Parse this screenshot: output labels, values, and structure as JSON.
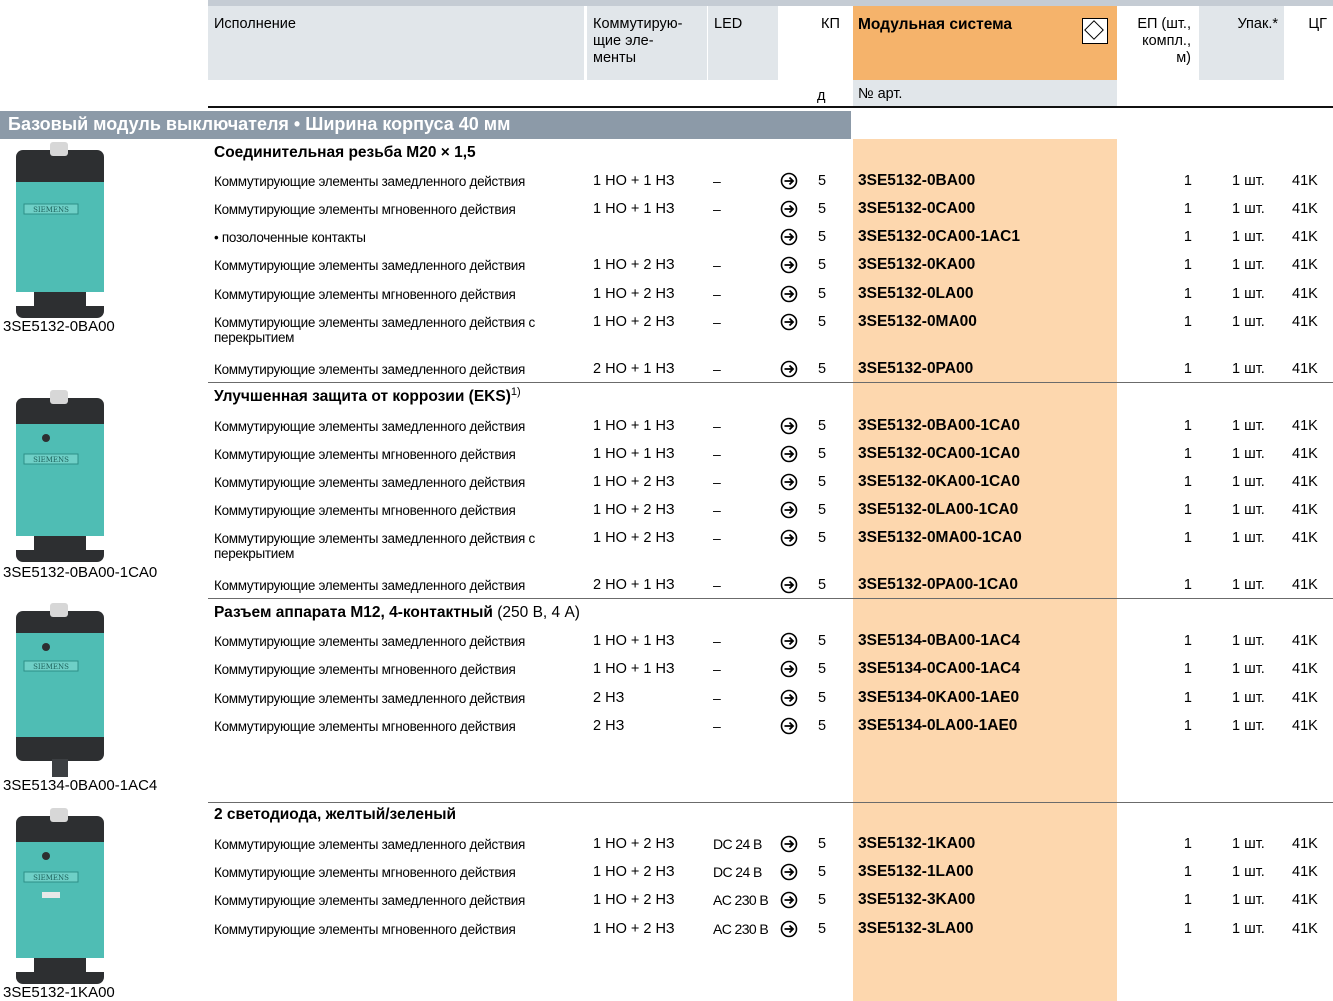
{
  "header": {
    "execution": "Исполнение",
    "switching": "Коммутирую-\nщие эле-\nменты",
    "led": "LED",
    "kp": "КП",
    "kp_unit": "д",
    "modular": "Модульная система",
    "article_no": "№ арт.",
    "ep": "ЕП (шт.,\nкомпл.,\nм)",
    "pack": "Упак.*",
    "cg": "ЦГ"
  },
  "section_title": "Базовый модуль выключателя • Ширина корпуса 40 мм",
  "images": {
    "img1": "3SE5132-0BA00",
    "img2": "3SE5132-0BA00-1CA0",
    "img3": "3SE5134-0BA00-1AC4",
    "img4": "3SE5132-1KA00",
    "brand": "SIEMENS"
  },
  "groups": [
    {
      "title": "Соединительная резьба M20 × 1,5",
      "title_suffix": "",
      "title_sup": "",
      "rows": [
        {
          "desc": "Коммутирующие элементы замедленного действия",
          "sw": "1 НО + 1 НЗ",
          "led": "–",
          "kp": "5",
          "art": "3SE5132-0BA00",
          "ep": "1",
          "pack": "1 шт.",
          "cg": "41K"
        },
        {
          "desc": "Коммутирующие элементы мгновенного действия",
          "sw": "1 НО + 1 НЗ",
          "led": "–",
          "kp": "5",
          "art": "3SE5132-0CA00",
          "ep": "1",
          "pack": "1 шт.",
          "cg": "41K"
        },
        {
          "desc": "• позолоченные контакты",
          "sw": "",
          "led": "",
          "kp": "5",
          "art": "3SE5132-0CA00-1AC1",
          "ep": "1",
          "pack": "1 шт.",
          "cg": "41K"
        },
        {
          "desc": "Коммутирующие элементы замедленного действия",
          "sw": "1 НО + 2 НЗ",
          "led": "–",
          "kp": "5",
          "art": "3SE5132-0KA00",
          "ep": "1",
          "pack": "1 шт.",
          "cg": "41K"
        },
        {
          "desc": "Коммутирующие элементы мгновенного действия",
          "sw": "1 НО + 2 НЗ",
          "led": "–",
          "kp": "5",
          "art": "3SE5132-0LA00",
          "ep": "1",
          "pack": "1 шт.",
          "cg": "41K"
        },
        {
          "desc": "Коммутирующие элементы замедленного действия с перекрытием",
          "sw": "1 НО + 2 НЗ",
          "led": "–",
          "kp": "5",
          "art": "3SE5132-0MA00",
          "ep": "1",
          "pack": "1 шт.",
          "cg": "41K"
        },
        {
          "desc": "Коммутирующие элементы замедленного действия",
          "sw": "2 НО + 1 НЗ",
          "led": "–",
          "kp": "5",
          "art": "3SE5132-0PA00",
          "ep": "1",
          "pack": "1 шт.",
          "cg": "41K"
        }
      ]
    },
    {
      "title": "Улучшенная защита от коррозии (EKS)",
      "title_suffix": "",
      "title_sup": "1)",
      "rows": [
        {
          "desc": "Коммутирующие элементы замедленного действия",
          "sw": "1 НО + 1 НЗ",
          "led": "–",
          "kp": "5",
          "art": "3SE5132-0BA00-1CA0",
          "ep": "1",
          "pack": "1 шт.",
          "cg": "41K"
        },
        {
          "desc": "Коммутирующие элементы мгновенного действия",
          "sw": "1 НО + 1 НЗ",
          "led": "–",
          "kp": "5",
          "art": "3SE5132-0CA00-1CA0",
          "ep": "1",
          "pack": "1 шт.",
          "cg": "41K"
        },
        {
          "desc": "Коммутирующие элементы замедленного действия",
          "sw": "1 НО + 2 НЗ",
          "led": "–",
          "kp": "5",
          "art": "3SE5132-0KA00-1CA0",
          "ep": "1",
          "pack": "1 шт.",
          "cg": "41K"
        },
        {
          "desc": "Коммутирующие элементы мгновенного действия",
          "sw": "1 НО + 2 НЗ",
          "led": "–",
          "kp": "5",
          "art": "3SE5132-0LA00-1CA0",
          "ep": "1",
          "pack": "1 шт.",
          "cg": "41K"
        },
        {
          "desc": "Коммутирующие элементы замедленного действия с перекрытием",
          "sw": "1 НО + 2 НЗ",
          "led": "–",
          "kp": "5",
          "art": "3SE5132-0MA00-1CA0",
          "ep": "1",
          "pack": "1 шт.",
          "cg": "41K"
        },
        {
          "desc": "Коммутирующие элементы замедленного действия",
          "sw": "2 НО + 1 НЗ",
          "led": "–",
          "kp": "5",
          "art": "3SE5132-0PA00-1CA0",
          "ep": "1",
          "pack": "1 шт.",
          "cg": "41K"
        }
      ]
    },
    {
      "title": "Разъем аппарата M12, 4-контактный",
      "title_suffix": " (250 В, 4 А)",
      "title_sup": "",
      "rows": [
        {
          "desc": "Коммутирующие элементы замедленного действия",
          "sw": "1 НО + 1 НЗ",
          "led": "–",
          "kp": "5",
          "art": "3SE5134-0BA00-1AC4",
          "ep": "1",
          "pack": "1 шт.",
          "cg": "41K"
        },
        {
          "desc": "Коммутирующие элементы мгновенного действия",
          "sw": "1 НО + 1 НЗ",
          "led": "–",
          "kp": "5",
          "art": "3SE5134-0CA00-1AC4",
          "ep": "1",
          "pack": "1 шт.",
          "cg": "41K"
        },
        {
          "desc": "Коммутирующие элементы замедленного действия",
          "sw": "2 НЗ",
          "led": "–",
          "kp": "5",
          "art": "3SE5134-0KA00-1AE0",
          "ep": "1",
          "pack": "1 шт.",
          "cg": "41K"
        },
        {
          "desc": "Коммутирующие элементы мгновенного действия",
          "sw": "2 НЗ",
          "led": "–",
          "kp": "5",
          "art": "3SE5134-0LA00-1AE0",
          "ep": "1",
          "pack": "1 шт.",
          "cg": "41K"
        }
      ]
    },
    {
      "title": "2 светодиода, желтый/зеленый",
      "title_suffix": "",
      "title_sup": "",
      "rows": [
        {
          "desc": "Коммутирующие элементы замедленного действия",
          "sw": "1 НО + 2 НЗ",
          "led": "DC 24 В",
          "kp": "5",
          "art": "3SE5132-1KA00",
          "ep": "1",
          "pack": "1 шт.",
          "cg": "41K"
        },
        {
          "desc": "Коммутирующие элементы мгновенного действия",
          "sw": "1 НО + 2 НЗ",
          "led": "DC 24 В",
          "kp": "5",
          "art": "3SE5132-1LA00",
          "ep": "1",
          "pack": "1 шт.",
          "cg": "41K"
        },
        {
          "desc": "Коммутирующие элементы замедленного действия",
          "sw": "1 НО + 2 НЗ",
          "led": "AC 230 В",
          "kp": "5",
          "art": "3SE5132-3KA00",
          "ep": "1",
          "pack": "1 шт.",
          "cg": "41K"
        },
        {
          "desc": "Коммутирующие элементы мгновенного действия",
          "sw": "1 НО + 2 НЗ",
          "led": "AC 230 В",
          "kp": "5",
          "art": "3SE5132-3LA00",
          "ep": "1",
          "pack": "1 шт.",
          "cg": "41K"
        }
      ]
    }
  ],
  "colors": {
    "header_gray": "#e1e6ea",
    "header_orange": "#f5b36b",
    "orange_column": "#fdd7ae",
    "section_bar": "#8c9aa8",
    "product_teal": "#4fbdb4",
    "product_dark": "#2d2f31"
  },
  "icons": {
    "modular": "diamond-in-square-icon",
    "delivery": "circled-arrow-icon"
  }
}
